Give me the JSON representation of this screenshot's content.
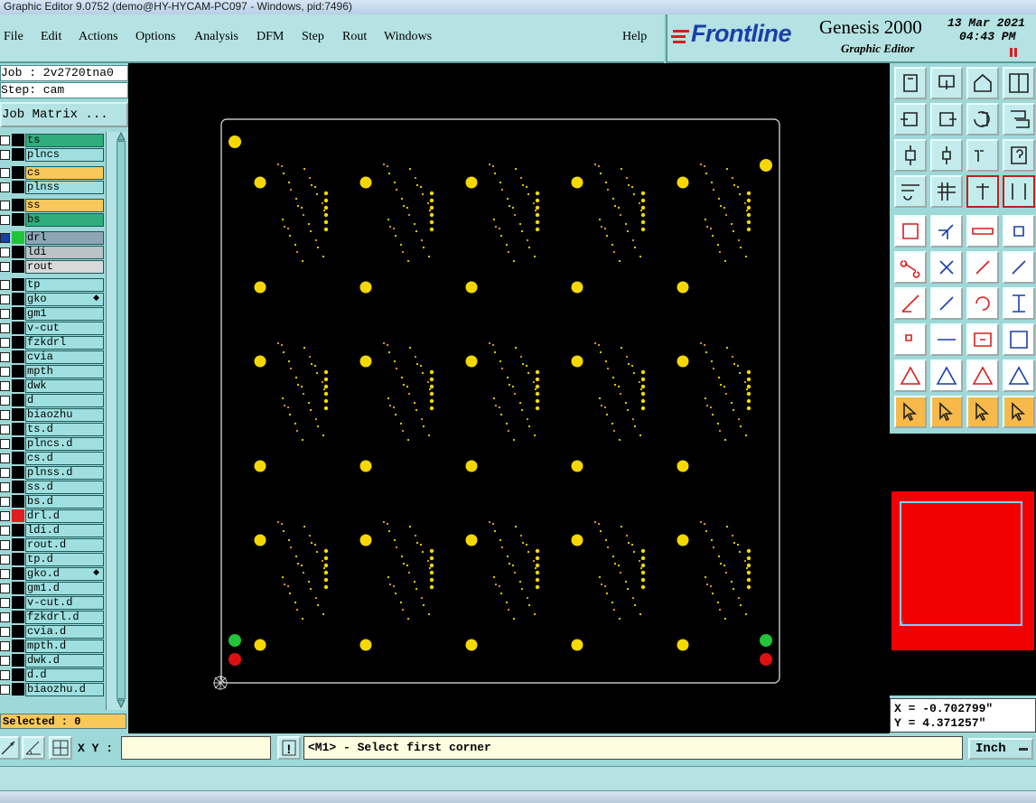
{
  "window": {
    "title": "Graphic Editor 9.0752 (demo@HY-HYCAM-PC097 - Windows, pid:7496)"
  },
  "menu": [
    "File",
    "Edit",
    "Actions",
    "Options",
    "Analysis",
    "DFM",
    "Step",
    "Rout",
    "Windows"
  ],
  "menu_help": "Help",
  "brand": {
    "name": "Frontline",
    "app": "Genesis 2000",
    "sub": "Graphic Editor",
    "date": "13 Mar 2021",
    "time": "04:43 PM"
  },
  "job": {
    "job_line": "Job : 2v2720tna0",
    "step_line": "Step: cam",
    "matrix_button": "Job Matrix ..."
  },
  "layers": [
    {
      "name": "ts",
      "color": "#2fae7c",
      "swatch": "#000"
    },
    {
      "name": "plncs",
      "color": "#9ee0e0",
      "swatch": "#000"
    },
    {
      "name": "cs",
      "color": "#f9c85a",
      "swatch": "#000"
    },
    {
      "name": "plnss",
      "color": "#9ee0e0",
      "swatch": "#000"
    },
    {
      "name": "ss",
      "color": "#f9c85a",
      "swatch": "#000"
    },
    {
      "name": "bs",
      "color": "#2fae7c",
      "swatch": "#000"
    },
    {
      "name": "drl",
      "color": "#8ea6b4",
      "swatch": "#22c43a",
      "selected": true
    },
    {
      "name": "ldi",
      "color": "#b9c3c8",
      "swatch": "#000"
    },
    {
      "name": "rout",
      "color": "#d9d9d9",
      "swatch": "#000"
    },
    {
      "name": "tp",
      "color": "#9ee0e0",
      "swatch": "#000"
    },
    {
      "name": "gko",
      "color": "#9ee0e0",
      "swatch": "#000",
      "mark": true
    },
    {
      "name": "gm1",
      "color": "#9ee0e0",
      "swatch": "#000"
    },
    {
      "name": "v-cut",
      "color": "#9ee0e0",
      "swatch": "#000"
    },
    {
      "name": "fzkdrl",
      "color": "#9ee0e0",
      "swatch": "#000"
    },
    {
      "name": "cvia",
      "color": "#9ee0e0",
      "swatch": "#000"
    },
    {
      "name": "mpth",
      "color": "#9ee0e0",
      "swatch": "#000"
    },
    {
      "name": "dwk",
      "color": "#9ee0e0",
      "swatch": "#000"
    },
    {
      "name": "d",
      "color": "#9ee0e0",
      "swatch": "#000"
    },
    {
      "name": "biaozhu",
      "color": "#9ee0e0",
      "swatch": "#000"
    },
    {
      "name": "ts.d",
      "color": "#9ee0e0",
      "swatch": "#000"
    },
    {
      "name": "plncs.d",
      "color": "#9ee0e0",
      "swatch": "#000"
    },
    {
      "name": "cs.d",
      "color": "#9ee0e0",
      "swatch": "#000"
    },
    {
      "name": "plnss.d",
      "color": "#9ee0e0",
      "swatch": "#000"
    },
    {
      "name": "ss.d",
      "color": "#9ee0e0",
      "swatch": "#000"
    },
    {
      "name": "bs.d",
      "color": "#9ee0e0",
      "swatch": "#000"
    },
    {
      "name": "drl.d",
      "color": "#9ee0e0",
      "swatch": "#e02020"
    },
    {
      "name": "ldi.d",
      "color": "#9ee0e0",
      "swatch": "#000"
    },
    {
      "name": "rout.d",
      "color": "#9ee0e0",
      "swatch": "#000"
    },
    {
      "name": "tp.d",
      "color": "#9ee0e0",
      "swatch": "#000"
    },
    {
      "name": "gko.d",
      "color": "#9ee0e0",
      "swatch": "#000",
      "mark": true
    },
    {
      "name": "gm1.d",
      "color": "#9ee0e0",
      "swatch": "#000"
    },
    {
      "name": "v-cut.d",
      "color": "#9ee0e0",
      "swatch": "#000"
    },
    {
      "name": "fzkdrl.d",
      "color": "#9ee0e0",
      "swatch": "#000"
    },
    {
      "name": "cvia.d",
      "color": "#9ee0e0",
      "swatch": "#000"
    },
    {
      "name": "mpth.d",
      "color": "#9ee0e0",
      "swatch": "#000"
    },
    {
      "name": "dwk.d",
      "color": "#9ee0e0",
      "swatch": "#000"
    },
    {
      "name": "d.d",
      "color": "#9ee0e0",
      "swatch": "#000"
    },
    {
      "name": "biaozhu.d",
      "color": "#9ee0e0",
      "swatch": "#000"
    }
  ],
  "selected": "Selected : 0",
  "coords": {
    "x_line": "X = -0.702799\"",
    "y_line": "Y = 4.371257\""
  },
  "bottom": {
    "xy_label": "X Y :",
    "xy_value": "",
    "message": "<M1> - Select first corner",
    "units": "Inch"
  },
  "colors": {
    "canvas": "#000000",
    "pad": "#f5d800",
    "green_pad": "#22c43a",
    "red_pad": "#e01010",
    "preview": "#f20000"
  }
}
